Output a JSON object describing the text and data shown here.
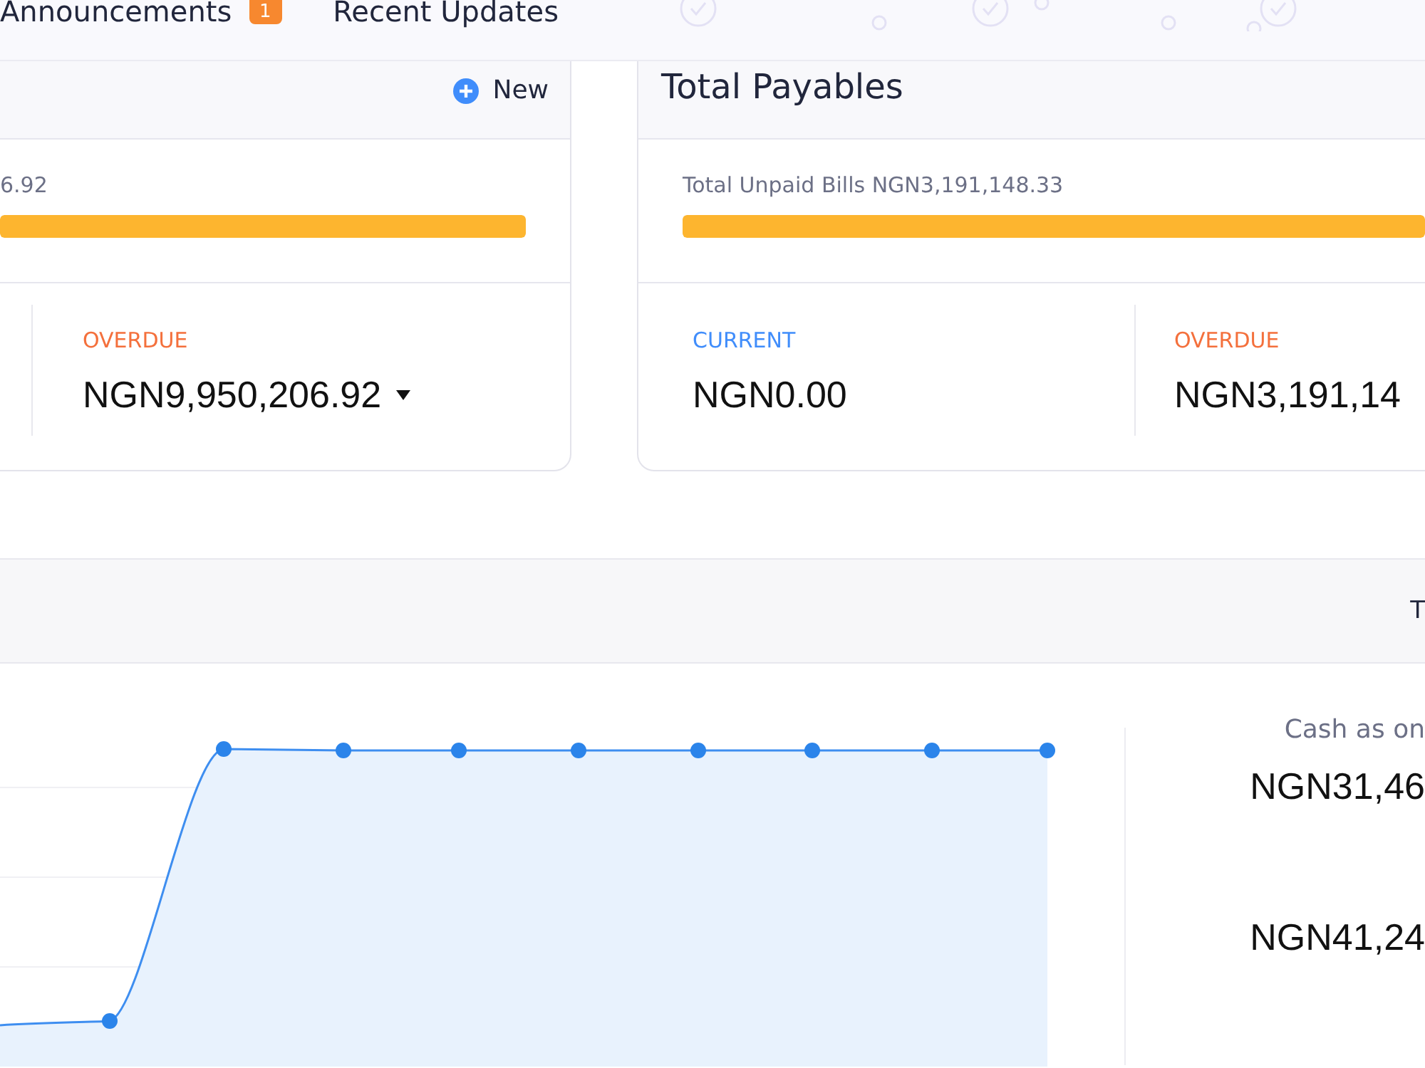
{
  "tabs": [
    {
      "label": "Announcements",
      "badge": "1"
    },
    {
      "label": "Recent Updates"
    }
  ],
  "left_card": {
    "new_button": "New",
    "summary": "6.92",
    "progress": {
      "level": 1
    },
    "aging": [
      {
        "kind": "overdue",
        "label": "OVERDUE",
        "amount": "NGN9,950,206.92",
        "menu": true
      }
    ]
  },
  "right_card": {
    "title": "Total Payables",
    "summary": "Total Unpaid Bills NGN3,191,148.33",
    "progress": {
      "level": 1
    },
    "aging": [
      {
        "kind": "current",
        "label": "CURRENT",
        "amount": "NGN0.00",
        "menu": false
      },
      {
        "kind": "overdue",
        "label": "OVERDUE",
        "amount": "NGN3,191,14",
        "menu": false
      }
    ]
  },
  "section_header": {
    "label": "T"
  },
  "cash_panel": {
    "label": "Cash as on",
    "amounts": [
      "NGN31,46",
      "NGN41,24"
    ]
  }
}
